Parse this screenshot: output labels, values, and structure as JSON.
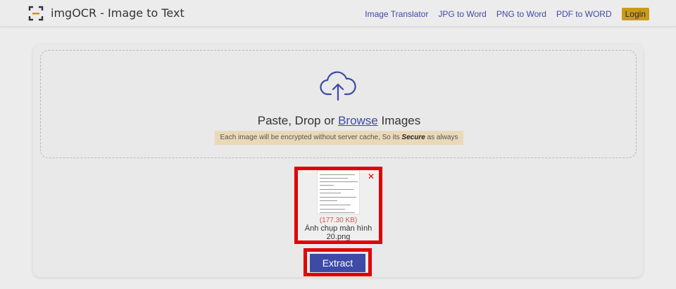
{
  "header": {
    "brand": "imgOCR - Image to Text",
    "logo_icon": "scan-frame-icon",
    "nav": [
      {
        "label": "Image Translator"
      },
      {
        "label": "JPG to Word"
      },
      {
        "label": "PNG to Word"
      },
      {
        "label": "PDF to WORD"
      }
    ],
    "login_label": "Login"
  },
  "upload": {
    "icon": "cloud-upload-icon",
    "prompt_before": "Paste, Drop or ",
    "browse_label": "Browse",
    "prompt_after": " Images",
    "notice_before": "Each image will be encrypted without server cache, So its ",
    "notice_emphasis": "Secure",
    "notice_after": " as always"
  },
  "file": {
    "size": "(177.30 KB)",
    "name": "Ảnh chụp màn hình 20.png",
    "remove_icon": "close-icon"
  },
  "actions": {
    "extract_label": "Extract"
  },
  "colors": {
    "accent": "#3d4aa6",
    "login_bg": "#c99a1c",
    "highlight": "#e00000",
    "notice_bg": "#ead9b8"
  }
}
